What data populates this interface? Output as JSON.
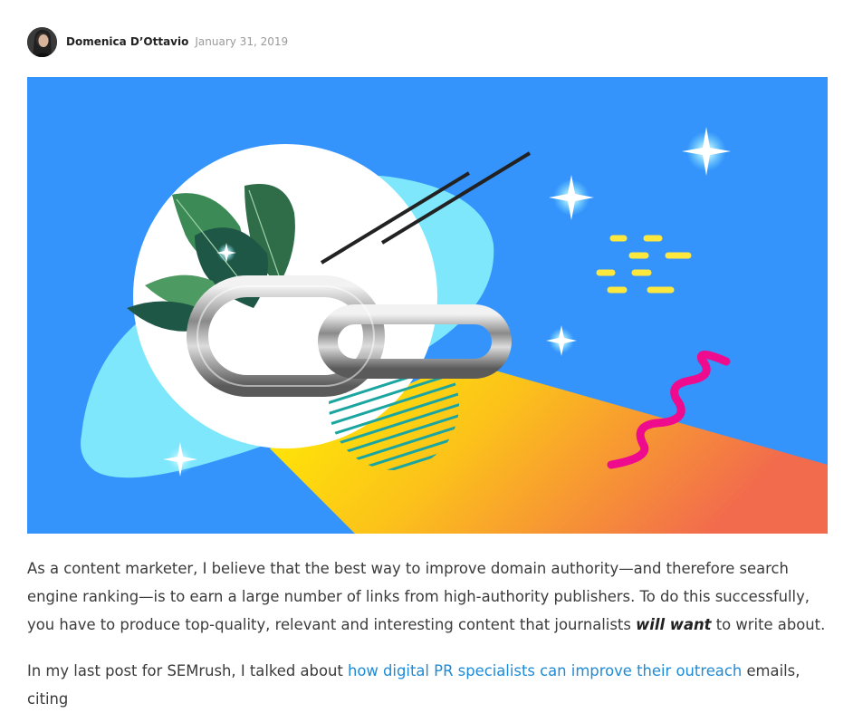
{
  "byline": {
    "author": "Domenica D’Ottavio",
    "date": "January 31, 2019"
  },
  "hero": {
    "icon": "link-chain-illustration",
    "colors": {
      "background": "#3494fc",
      "circle": "#ffffff",
      "blob": "#7ee7fb",
      "beam_start": "#fff200",
      "beam_end": "#f26b4d",
      "squiggle": "#ee0b8e",
      "dashes": "#ffe83d",
      "stripes": "#1aa5a0",
      "leaves": "#3c8a55"
    }
  },
  "article": {
    "p1_text_1": "As a content marketer, I believe that the best way to improve domain authority—and therefore search engine ranking—is to earn a large number of links from high-authority publishers. To do this successfully, you have to produce top-quality, relevant and interesting content that journalists ",
    "p1_emphasis": "will want",
    "p1_text_2": " to write about.",
    "p2_text_1": "In my last post for SEMrush, I talked about ",
    "p2_link": "how digital PR specialists can improve their outreach",
    "p2_text_2": " emails, citing"
  },
  "colors": {
    "text": "#3b3b3b",
    "link": "#1f8bd6",
    "date": "#9a9a9a"
  }
}
